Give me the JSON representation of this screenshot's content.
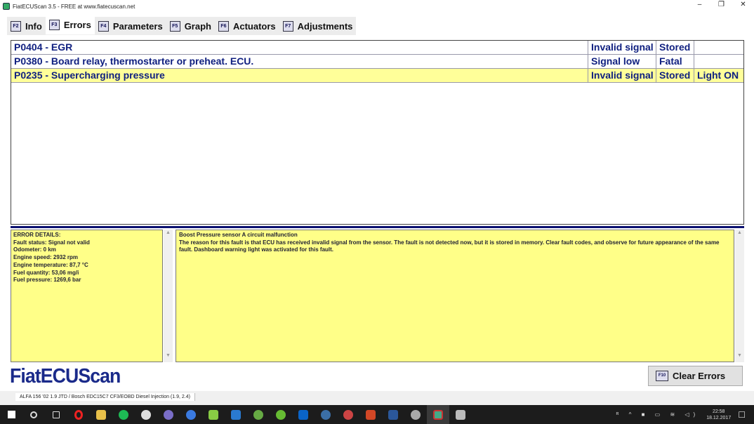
{
  "window": {
    "title": "FiatECUScan 3.5 - FREE at www.fiatecuscan.net",
    "minimize": "–",
    "restore": "❐",
    "close": "✕"
  },
  "tabs": [
    {
      "key": "F2",
      "label": "Info"
    },
    {
      "key": "F3",
      "label": "Errors"
    },
    {
      "key": "F4",
      "label": "Parameters"
    },
    {
      "key": "F5",
      "label": "Graph"
    },
    {
      "key": "F6",
      "label": "Actuators"
    },
    {
      "key": "F7",
      "label": "Adjustments"
    }
  ],
  "errors": [
    {
      "code": "P0404 - EGR",
      "type": "Invalid signal",
      "state": "Stored",
      "light": ""
    },
    {
      "code": "P0380 - Board relay, thermostarter or preheat. ECU.",
      "type": "Signal low",
      "state": "Fatal",
      "light": ""
    },
    {
      "code": "P0235 - Supercharging pressure",
      "type": "Invalid signal",
      "state": "Stored",
      "light": "Light ON"
    }
  ],
  "details": [
    "ERROR DETAILS:",
    "Fault status: Signal not valid",
    "Odometer: 0 km",
    "Engine speed: 2932 rpm",
    "Engine temperature: 87,7 °C",
    "Fuel quantity: 53,06 mg/i",
    "Fuel pressure: 1269,6 bar"
  ],
  "description": {
    "title": "Boost Pressure sensor A circuit malfunction",
    "body": "The reason for this fault is that ECU has received invalid signal from the sensor. The fault is not detected now, but it is stored in memory. Clear fault codes, and observe for future appearance of the same fault. Dashboard warning light was activated for this fault."
  },
  "logo": "FiatECUScan",
  "clear_button": {
    "key": "F10",
    "label": "Clear Errors"
  },
  "status_bar": "ALFA 156 '02 1.9 JTD / Bosch EDC15C7 CF3/EOBD Diesel Injection (1.9, 2.4)",
  "taskbar": {
    "time": "22:58",
    "date": "18.12.2017"
  },
  "colors": {
    "selected_row": "#ffff99",
    "text_blue": "#102080",
    "panel_yellow": "#ffff88"
  }
}
